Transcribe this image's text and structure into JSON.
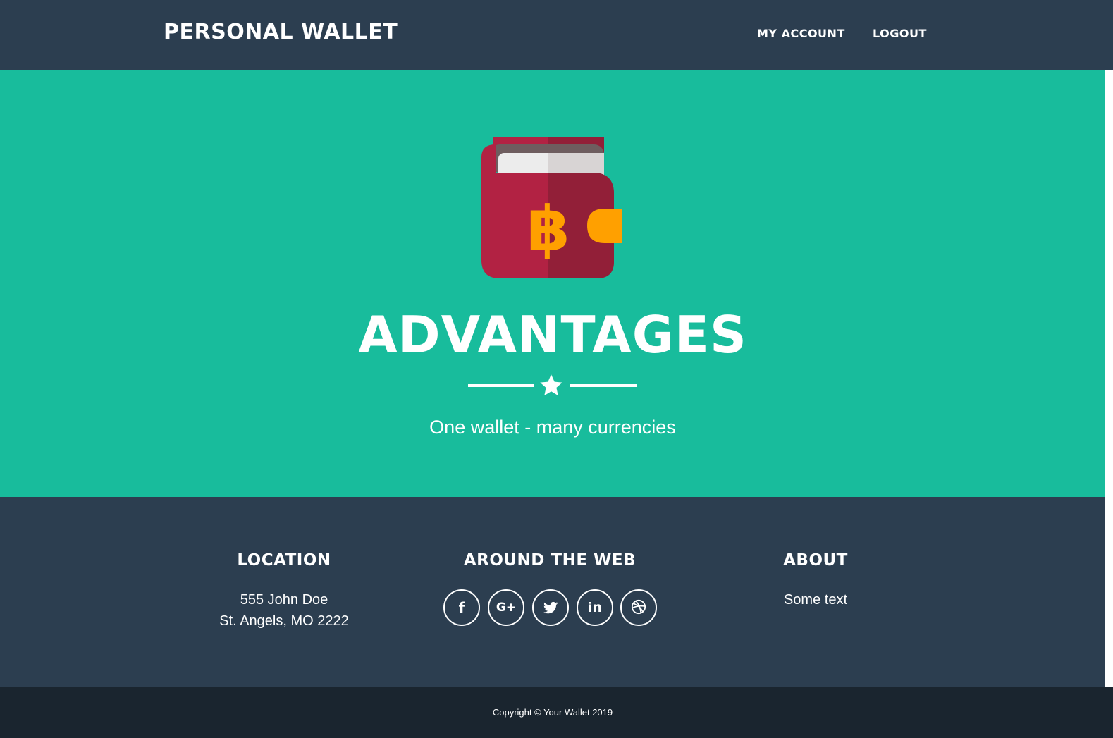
{
  "nav": {
    "brand": "PERSONAL WALLET",
    "links": [
      {
        "label": "MY ACCOUNT"
      },
      {
        "label": "LOGOUT"
      }
    ]
  },
  "hero": {
    "icon": "bitcoin-wallet-icon",
    "title": "ADVANTAGES",
    "divider_icon": "star-icon",
    "subtitle": "One wallet - many currencies"
  },
  "footer": {
    "location": {
      "title": "LOCATION",
      "line1": "555 John Doe",
      "line2": "St. Angels, MO 2222"
    },
    "web": {
      "title": "AROUND THE WEB",
      "icons": [
        {
          "name": "facebook-icon",
          "glyph": "f"
        },
        {
          "name": "google-plus-icon",
          "glyph": "G+"
        },
        {
          "name": "twitter-icon"
        },
        {
          "name": "linkedin-icon",
          "glyph": "in"
        },
        {
          "name": "dribbble-icon"
        }
      ]
    },
    "about": {
      "title": "ABOUT",
      "text": "Some text"
    }
  },
  "copyright": "Copyright © Your Wallet 2019",
  "colors": {
    "navbar": "#2c3e50",
    "hero": "#18bc9c",
    "copyright_bar": "#1a252f",
    "wallet_red": "#b22243",
    "wallet_dark_red": "#921f38",
    "bitcoin_orange": "#ffa000"
  }
}
